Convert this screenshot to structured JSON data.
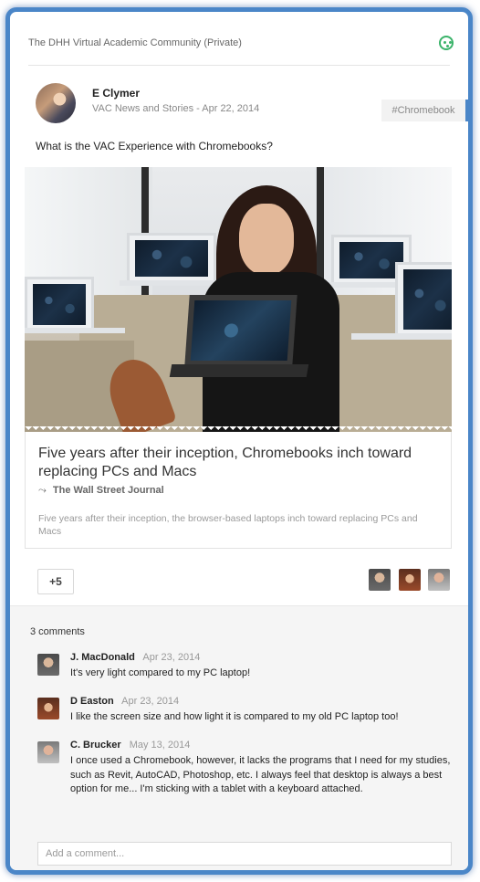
{
  "community": {
    "name": "The DHH Virtual Academic Community (Private)",
    "icon": "community-face-icon"
  },
  "post": {
    "author": "E Clymer",
    "category": "VAC News and Stories",
    "separator": "-",
    "date": "Apr 22, 2014",
    "hashtag": "#Chromebook",
    "text": "What is the VAC Experience with Chromebooks?"
  },
  "link": {
    "title": "Five years after their inception, Chromebooks inch toward replacing PCs and Macs",
    "source_icon": "⤳",
    "source": "The Wall Street Journal",
    "description": "Five years after their inception, the browser-based laptops inch toward replacing PCs and Macs"
  },
  "plus_one": {
    "label": "+5"
  },
  "comments": {
    "count_label": "3 comments",
    "items": [
      {
        "name": "J. MacDonald",
        "date": "Apr 23, 2014",
        "text": "It's very light compared to my PC laptop!"
      },
      {
        "name": "D Easton",
        "date": "Apr 23, 2014",
        "text": "I like the screen size and how light it is compared to my old PC laptop too!"
      },
      {
        "name": "C. Brucker",
        "date": "May 13, 2014",
        "text": "I once used a Chromebook, however, it lacks the programs that I need for my studies, such as Revit, AutoCAD, Photoshop, etc. I always feel that desktop is always a best option for me... I'm sticking with a tablet with a keyboard attached."
      }
    ],
    "add_placeholder": "Add a comment..."
  },
  "colors": {
    "frame": "#4a86c8",
    "community_icon": "#3bb36a"
  }
}
